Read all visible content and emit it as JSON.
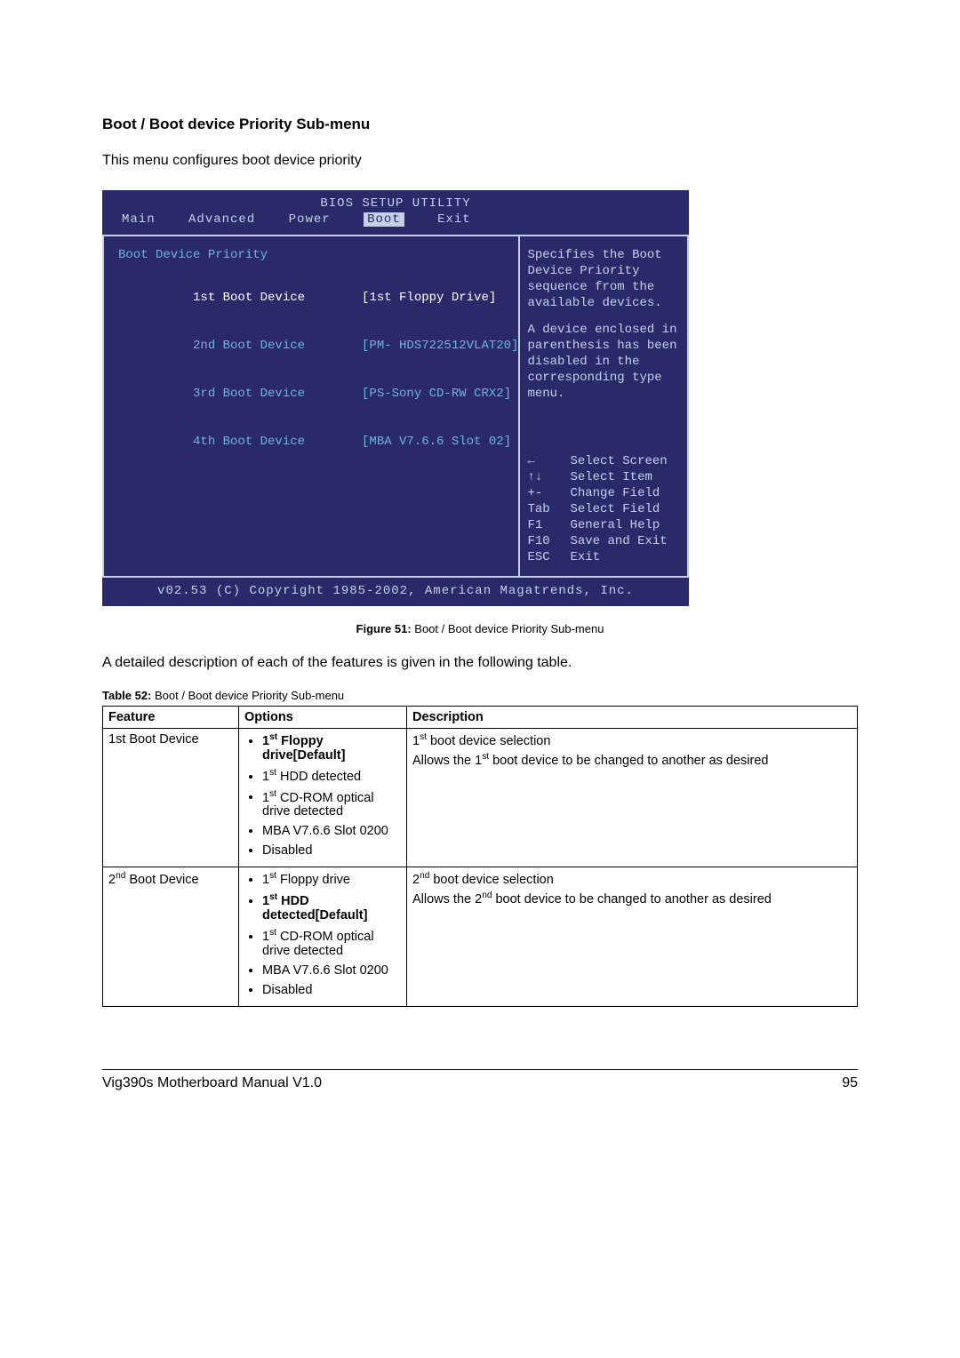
{
  "section_title": "Boot / Boot device Priority Sub-menu",
  "intro_text": "This menu configures boot device priority",
  "bios": {
    "title": "BIOS SETUP UTILITY",
    "menu": {
      "main": "Main",
      "advanced": "Advanced",
      "power": "Power",
      "boot": "Boot",
      "exit": "Exit"
    },
    "panel_title": "Boot Device Priority",
    "rows": [
      {
        "label": "1st Boot Device",
        "value": "[1st Floppy Drive]",
        "selected": true
      },
      {
        "label": "2nd Boot Device",
        "value": "[PM- HDS722512VLAT20]",
        "selected": false
      },
      {
        "label": "3rd Boot Device",
        "value": "[PS-Sony CD-RW CRX2]",
        "selected": false
      },
      {
        "label": "4th Boot Device",
        "value": "[MBA V7.6.6 Slot 02]",
        "selected": false
      }
    ],
    "help": {
      "line1": "Specifies the Boot",
      "line2": "Device Priority",
      "line3": "sequence from the",
      "line4": "available devices.",
      "line5": "A device enclosed in",
      "line6": "parenthesis has been",
      "line7": "disabled in the",
      "line8": "corresponding type",
      "line9": "menu."
    },
    "keys": {
      "k1l": "←",
      "k1t": "Select Screen",
      "k2l": "↑↓",
      "k2t": "Select Item",
      "k3l": "+-",
      "k3t": "Change Field",
      "k4l": "Tab",
      "k4t": "Select Field",
      "k5l": "F1",
      "k5t": "General Help",
      "k6l": "F10",
      "k6t": "Save and Exit",
      "k7l": "ESC",
      "k7t": "Exit"
    },
    "copyright": "v02.53 (C) Copyright 1985-2002, American Magatrends, Inc."
  },
  "figure_label": "Figure 51:",
  "figure_text": " Boot / Boot device Priority Sub-menu",
  "after_figure": "A detailed description of each of the features is given in the following table.",
  "table_label": "Table 52:",
  "table_label_text": " Boot / Boot device Priority Sub-menu",
  "headers": {
    "c1": "Feature",
    "c2": "Options",
    "c3": "Description"
  },
  "rows": {
    "r1": {
      "feature_pre": "1st Boot Device",
      "feature_sup": "",
      "opts": {
        "o1a": "1",
        "o1sup": "st",
        "o1b": " Floppy drive[Default]",
        "o2a": "1",
        "o2sup": "st",
        "o2b": " HDD detected",
        "o3a": "1",
        "o3sup": "st",
        "o3b": " CD-ROM optical drive detected",
        "o4": "MBA V7.6.6 Slot 0200",
        "o5": "Disabled"
      },
      "desc": {
        "d1a": "1",
        "d1sup": "st",
        "d1b": " boot device selection",
        "d2a": "Allows the 1",
        "d2sup": "st",
        "d2b": " boot device to be changed to another as desired"
      },
      "bold_first": true
    },
    "r2": {
      "feature_pre": "2",
      "feature_sup": "nd",
      "feature_post": " Boot Device",
      "opts": {
        "o1a": "1",
        "o1sup": "st",
        "o1b": " Floppy drive",
        "o2a": "1",
        "o2sup": "st",
        "o2b": " HDD detected[Default]",
        "o3a": "1",
        "o3sup": "st",
        "o3b": " CD-ROM optical drive detected",
        "o4": "MBA V7.6.6 Slot 0200",
        "o5": "Disabled"
      },
      "desc": {
        "d1a": "2",
        "d1sup": "nd",
        "d1b": " boot device selection",
        "d2a": "Allows the 2",
        "d2sup": "nd",
        "d2b": " boot device to be changed to another as desired"
      },
      "bold_second": true
    }
  },
  "footer": {
    "left": "Vig390s Motherboard Manual V1.0",
    "right": "95"
  }
}
